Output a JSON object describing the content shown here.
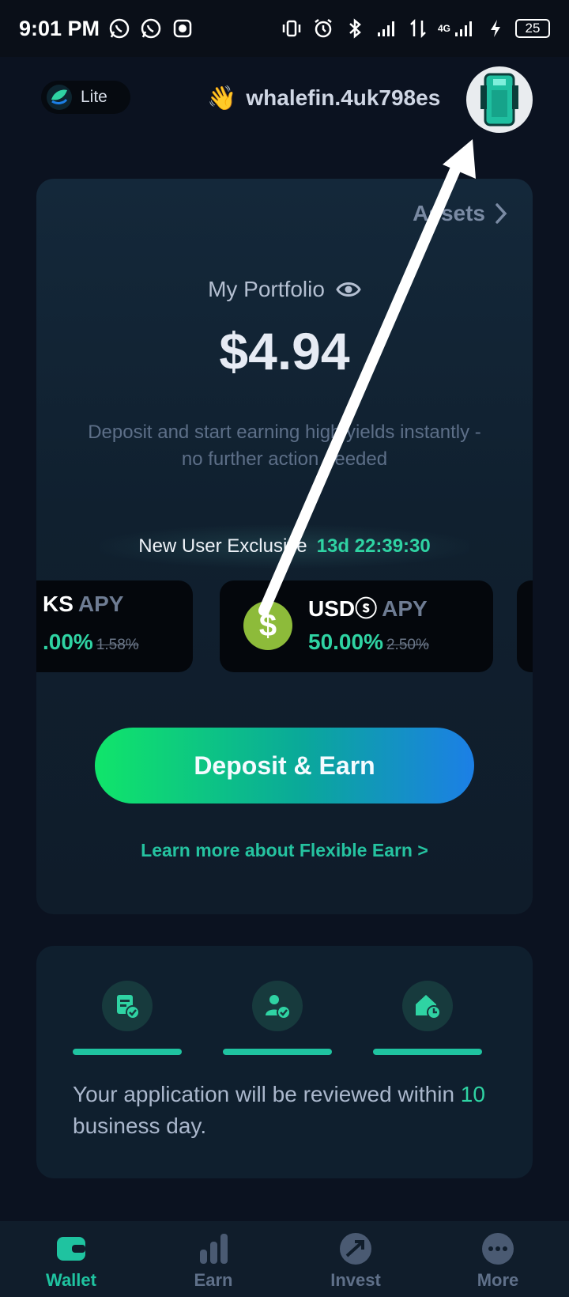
{
  "status_bar": {
    "time": "9:01 PM",
    "network": "4G",
    "battery": "25"
  },
  "header": {
    "mode_label": "Lite",
    "greeting_emoji": "👋",
    "username": "whalefin.4uk798es"
  },
  "portfolio": {
    "assets_label": "Assets",
    "title": "My Portfolio",
    "value": "$4.94",
    "description": "Deposit and start earning high yields instantly - no further action needed",
    "exclusive_label": "New User Exclusive",
    "exclusive_timer": "13d 22:39:30",
    "apy_cards": [
      {
        "symbol": "KS",
        "apy_word": "APY",
        "rate": ".00%",
        "old_rate": "1.58%"
      },
      {
        "symbol": "USDⓢ",
        "apy_word": "APY",
        "rate": "50.00%",
        "old_rate": "2.50%",
        "coin_glyph": "$"
      }
    ],
    "deposit_button": "Deposit & Earn",
    "learn_more": "Learn more about Flexible Earn >"
  },
  "review": {
    "steps": [
      "document-check-icon",
      "user-check-icon",
      "home-clock-icon"
    ],
    "text_before": "Your application will be reviewed within ",
    "days": "10",
    "text_after": " business day."
  },
  "nav": {
    "items": [
      {
        "label": "Wallet",
        "active": true
      },
      {
        "label": "Earn",
        "active": false
      },
      {
        "label": "Invest",
        "active": false
      },
      {
        "label": "More",
        "active": false
      }
    ]
  },
  "colors": {
    "accent": "#1fc3a0",
    "background": "#0b1220",
    "card": "#10202f"
  }
}
